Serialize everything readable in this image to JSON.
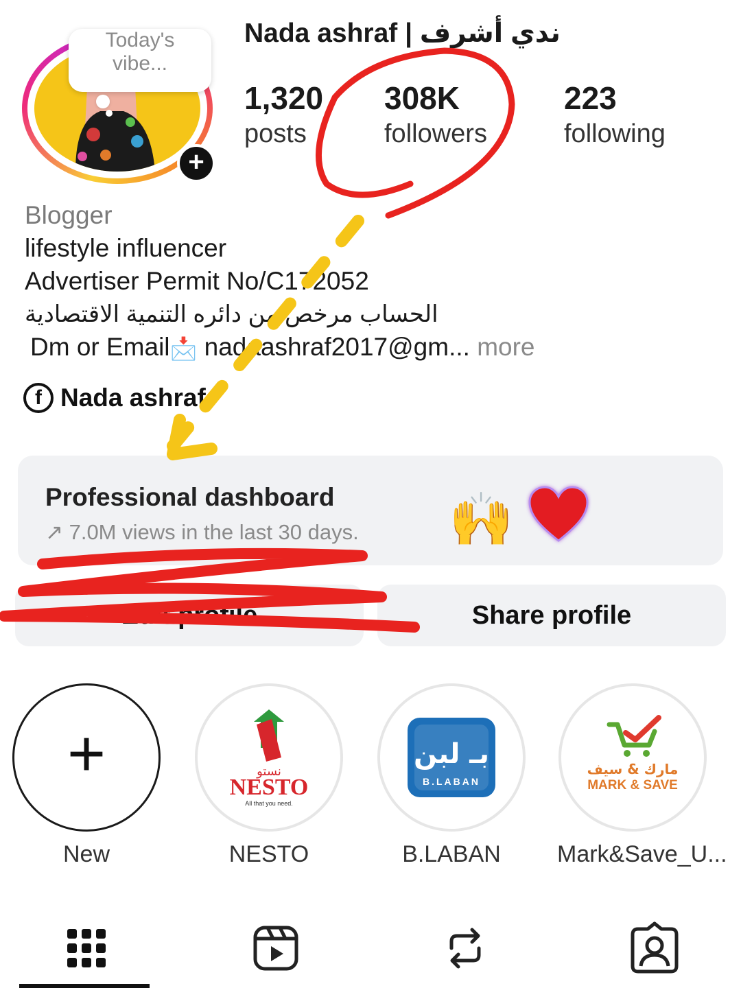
{
  "profile": {
    "note": "Today's\nvibe...",
    "name": "Nada ashraf | ندي أشرف",
    "add_story": "+"
  },
  "stats": [
    {
      "value": "1,320",
      "label": "posts"
    },
    {
      "value": "308K",
      "label": "followers"
    },
    {
      "value": "223",
      "label": "following"
    }
  ],
  "bio": {
    "category": "Blogger",
    "line1": "lifestyle influencer",
    "line2": "Advertiser Permit No/C172052",
    "line3": "الحساب مرخص من دائره التنمية الاقتصادية",
    "contact_prefix": "Dm or Email",
    "contact_icon": "📩",
    "contact_email": "nadaashraf2017@gm...",
    "more": "more"
  },
  "link": {
    "icon": "facebook-icon",
    "label": "Nada ashraf"
  },
  "dashboard": {
    "title": "Professional dashboard",
    "subtitle": "↗ 7.0M views in the last 30 days.",
    "emoji_hands": "🙌"
  },
  "buttons": {
    "edit": "Edit profile",
    "share": "Share profile"
  },
  "highlights": [
    {
      "label": "New"
    },
    {
      "label": "NESTO",
      "logo_text": "NESTO",
      "logo_arabic": "نستو",
      "logo_tagline": "All that you need."
    },
    {
      "label": "B.LABAN",
      "logo_text": "B.LABAN",
      "logo_arabic": "بـ لبن"
    },
    {
      "label": "Mark&Save_U...",
      "logo_text": "MARK & SAVE",
      "logo_arabic": "مارك & سيف"
    }
  ],
  "tabs": [
    {
      "icon": "grid-icon",
      "selected": true
    },
    {
      "icon": "reels-icon",
      "selected": false
    },
    {
      "icon": "reposts-icon",
      "selected": false
    },
    {
      "icon": "tagged-icon",
      "selected": false
    }
  ],
  "colors": {
    "annotation_red": "#e8231f",
    "annotation_yellow": "#f5c518",
    "ring_yellow": "#f9ce34",
    "ring_pink": "#ee2a7b",
    "ring_purple": "#c026d3"
  }
}
